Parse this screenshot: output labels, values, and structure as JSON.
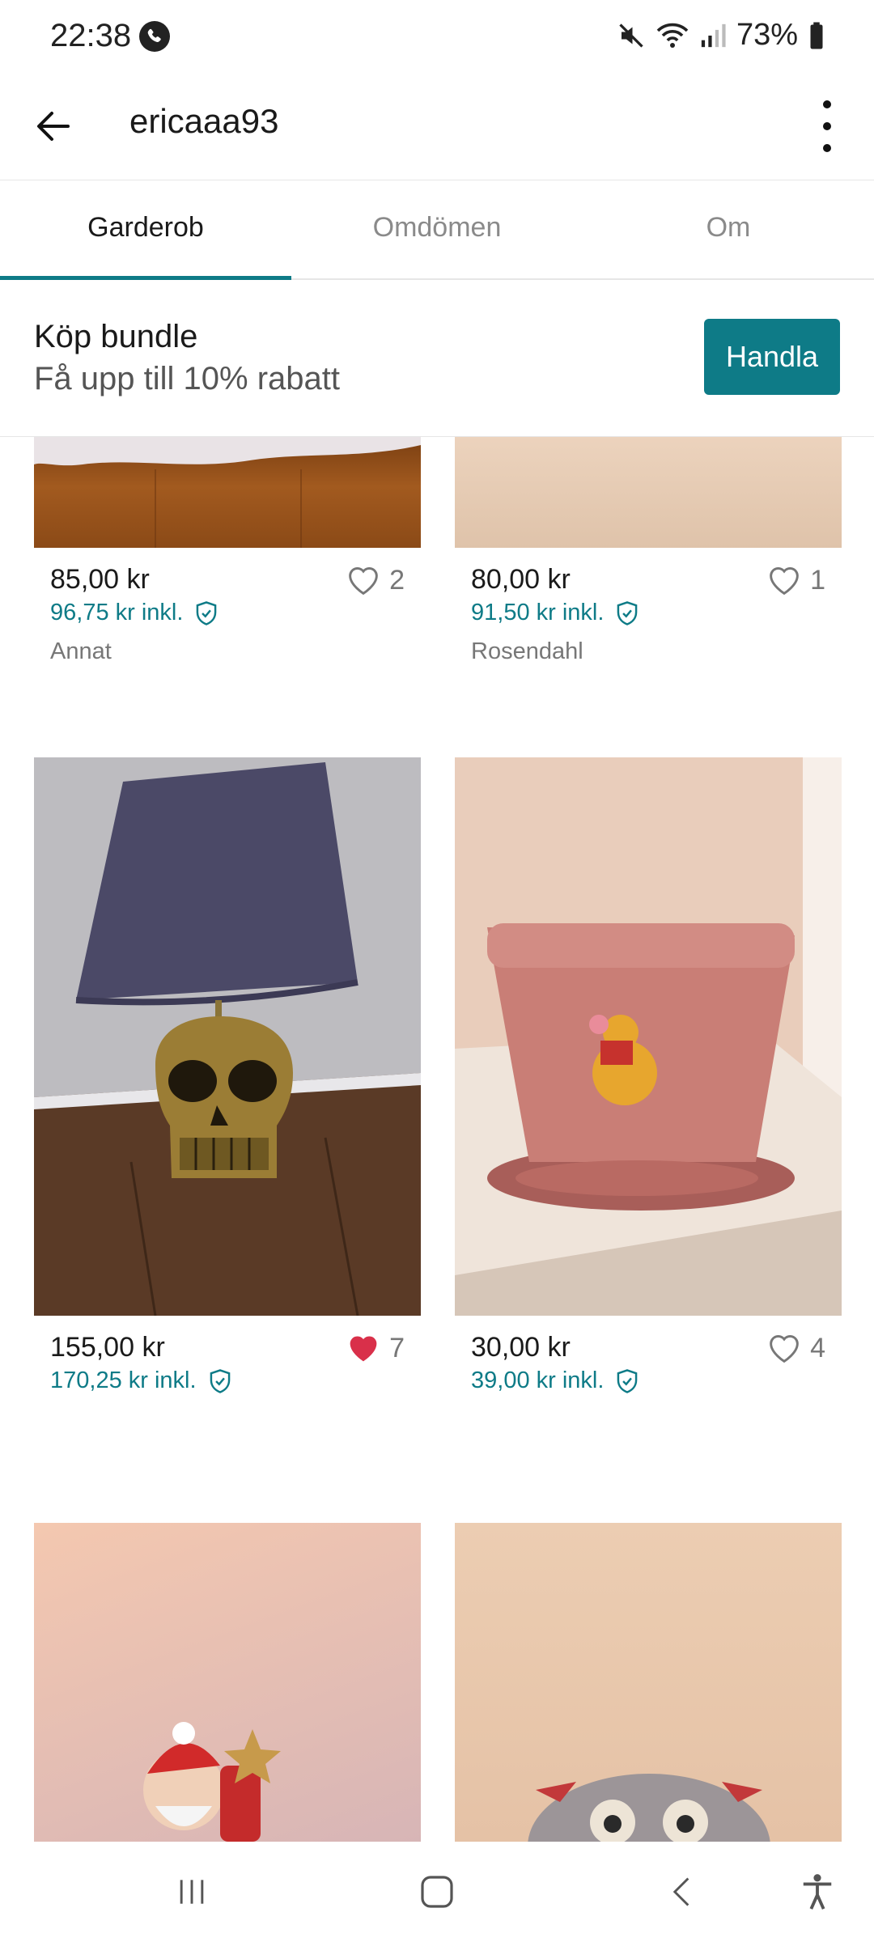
{
  "status_bar": {
    "time": "22:38",
    "battery": "73%"
  },
  "app_bar": {
    "title": "ericaaa93"
  },
  "tabs": [
    {
      "label": "Garderob",
      "active": true
    },
    {
      "label": "Omdömen",
      "active": false
    },
    {
      "label": "Om",
      "active": false
    }
  ],
  "bundle": {
    "title": "Köp bundle",
    "subtitle": "Få upp till 10% rabatt",
    "button_label": "Handla"
  },
  "items": [
    {
      "price": "85,00 kr",
      "price_incl": "96,75 kr inkl.",
      "brand": "Annat",
      "likes": "2",
      "liked": false
    },
    {
      "price": "80,00 kr",
      "price_incl": "91,50 kr inkl.",
      "brand": "Rosendahl",
      "likes": "1",
      "liked": false
    },
    {
      "price": "155,00 kr",
      "price_incl": "170,25 kr inkl.",
      "brand": "",
      "likes": "7",
      "liked": true
    },
    {
      "price": "30,00 kr",
      "price_incl": "39,00 kr inkl.",
      "brand": "",
      "likes": "4",
      "liked": false
    }
  ],
  "colors": {
    "accent": "#0e7b87",
    "liked_heart": "#d9304a"
  },
  "icons": [
    "back-arrow-icon",
    "more-vert-icon",
    "heart-icon",
    "shield-check-icon",
    "recents-icon",
    "home-icon",
    "nav-back-icon",
    "accessibility-icon"
  ]
}
